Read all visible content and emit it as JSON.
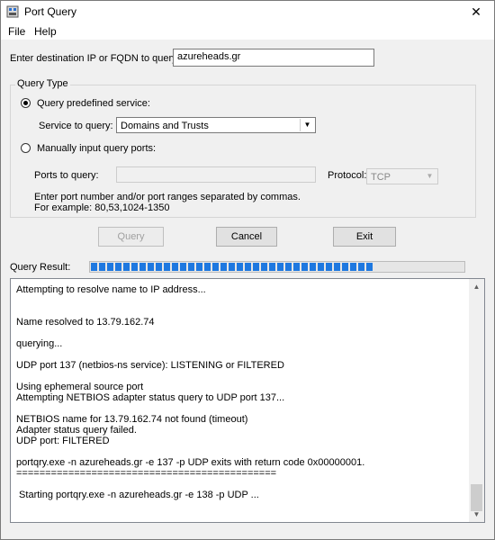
{
  "window": {
    "title": "Port Query",
    "close_glyph": "✕",
    "icon": "port-query-app-icon"
  },
  "menu": {
    "file": "File",
    "help": "Help"
  },
  "destination": {
    "label": "Enter destination IP or FQDN to query:",
    "value": "azureheads.gr"
  },
  "query_type": {
    "legend": "Query Type",
    "predefined_label": "Query predefined service:",
    "service_label": "Service to query:",
    "service_value": "Domains and Trusts",
    "manual_label": "Manually input query ports:",
    "ports_label": "Ports to query:",
    "ports_value": "",
    "protocol_label": "Protocol:",
    "protocol_value": "TCP",
    "help_line1": "Enter port number and/or port ranges separated by commas.",
    "help_line2": "For example: 80,53,1024-1350",
    "selected": "predefined"
  },
  "buttons": {
    "query": "Query",
    "cancel": "Cancel",
    "exit": "Exit"
  },
  "result": {
    "label": "Query Result:",
    "progress": 0.76
  },
  "output_lines": [
    "Attempting to resolve name to IP address...",
    "",
    "",
    "Name resolved to 13.79.162.74",
    "",
    "querying...",
    "",
    "UDP port 137 (netbios-ns service): LISTENING or FILTERED",
    "",
    "Using ephemeral source port",
    "Attempting NETBIOS adapter status query to UDP port 137...",
    "",
    "NETBIOS name for 13.79.162.74 not found (timeout)",
    "Adapter status query failed.",
    "UDP port: FILTERED",
    "",
    "portqry.exe -n azureheads.gr -e 137 -p UDP exits with return code 0x00000001.",
    "=============================================",
    "",
    " Starting portqry.exe -n azureheads.gr -e 138 -p UDP ..."
  ]
}
